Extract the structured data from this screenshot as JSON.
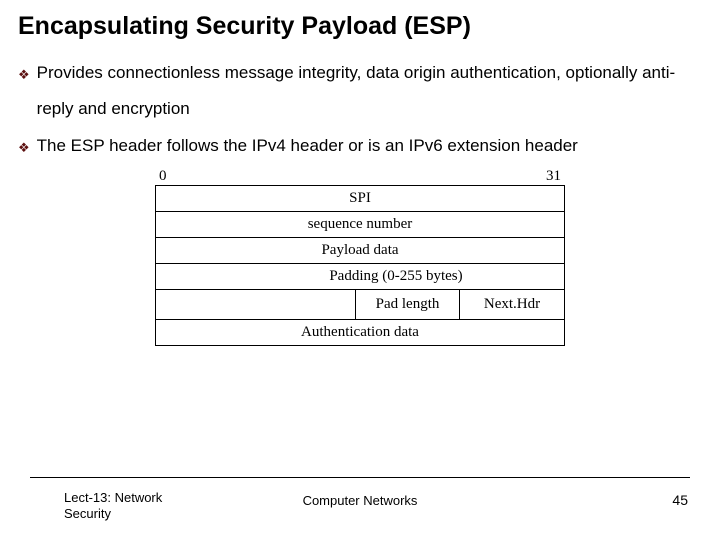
{
  "title": "Encapsulating Security Payload (ESP)",
  "bullets": [
    "Provides connectionless message integrity, data origin authentication, optionally anti-reply and encryption",
    "The ESP header follows the IPv4 header or is an IPv6 extension header"
  ],
  "diagram": {
    "bit_start": "0",
    "bit_end": "31",
    "rows": {
      "spi": "SPI",
      "seq": "sequence number",
      "payload": "Payload data",
      "padding": "Padding (0-255 bytes)",
      "pad_length": "Pad length",
      "next_hdr": "Next.Hdr",
      "auth_data": "Authentication data"
    }
  },
  "footer": {
    "left_line1": "Lect-13: Network",
    "left_line2": "Security",
    "center": "Computer Networks",
    "page": "45"
  },
  "bullet_glyph": "❖"
}
